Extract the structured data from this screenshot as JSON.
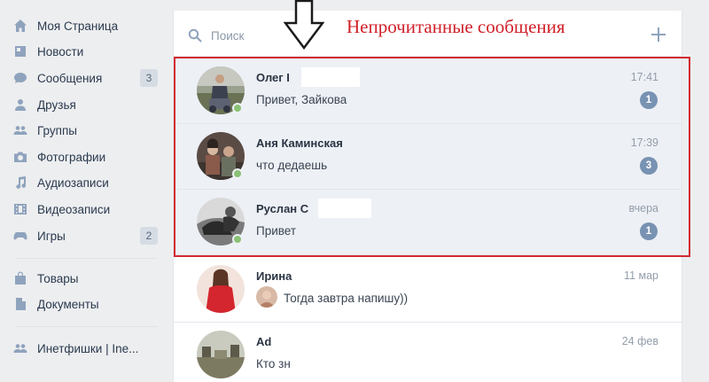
{
  "sidebar": {
    "items": [
      {
        "label": "Моя Страница",
        "icon": "home-icon"
      },
      {
        "label": "Новости",
        "icon": "news-icon"
      },
      {
        "label": "Сообщения",
        "icon": "messages-icon",
        "count": "3"
      },
      {
        "label": "Друзья",
        "icon": "friend-icon"
      },
      {
        "label": "Группы",
        "icon": "groups-icon"
      },
      {
        "label": "Фотографии",
        "icon": "camera-icon"
      },
      {
        "label": "Аудиозаписи",
        "icon": "music-icon"
      },
      {
        "label": "Видеозаписи",
        "icon": "video-icon"
      },
      {
        "label": "Игры",
        "icon": "gamepad-icon",
        "count": "2"
      },
      {
        "label": "Товары",
        "icon": "bag-icon"
      },
      {
        "label": "Документы",
        "icon": "document-icon"
      },
      {
        "label": "Инетфишки | Ine...",
        "icon": "community-icon"
      }
    ]
  },
  "search": {
    "placeholder": "Поиск"
  },
  "annotation": {
    "text": "Непрочитанные сообщения"
  },
  "dialogs": [
    {
      "name": "Олег I",
      "time": "17:41",
      "message": "Привет, Зайкова",
      "unread": "1"
    },
    {
      "name": "Аня Каминская",
      "time": "17:39",
      "message": "что дедаешь",
      "unread": "3"
    },
    {
      "name": "Руслан С",
      "time": "вчера",
      "message": "Привет",
      "unread": "1"
    },
    {
      "name": "Ирина",
      "time": "11 мар",
      "message": "Тогда завтра напишу))"
    },
    {
      "name": "Ad",
      "time": "24 фев",
      "message": "Кто зн"
    }
  ],
  "colors": {
    "accent": "#7892b2",
    "highlight_frame": "#d22b31",
    "online": "#8ac176",
    "unread_background": "#edf0f5"
  }
}
